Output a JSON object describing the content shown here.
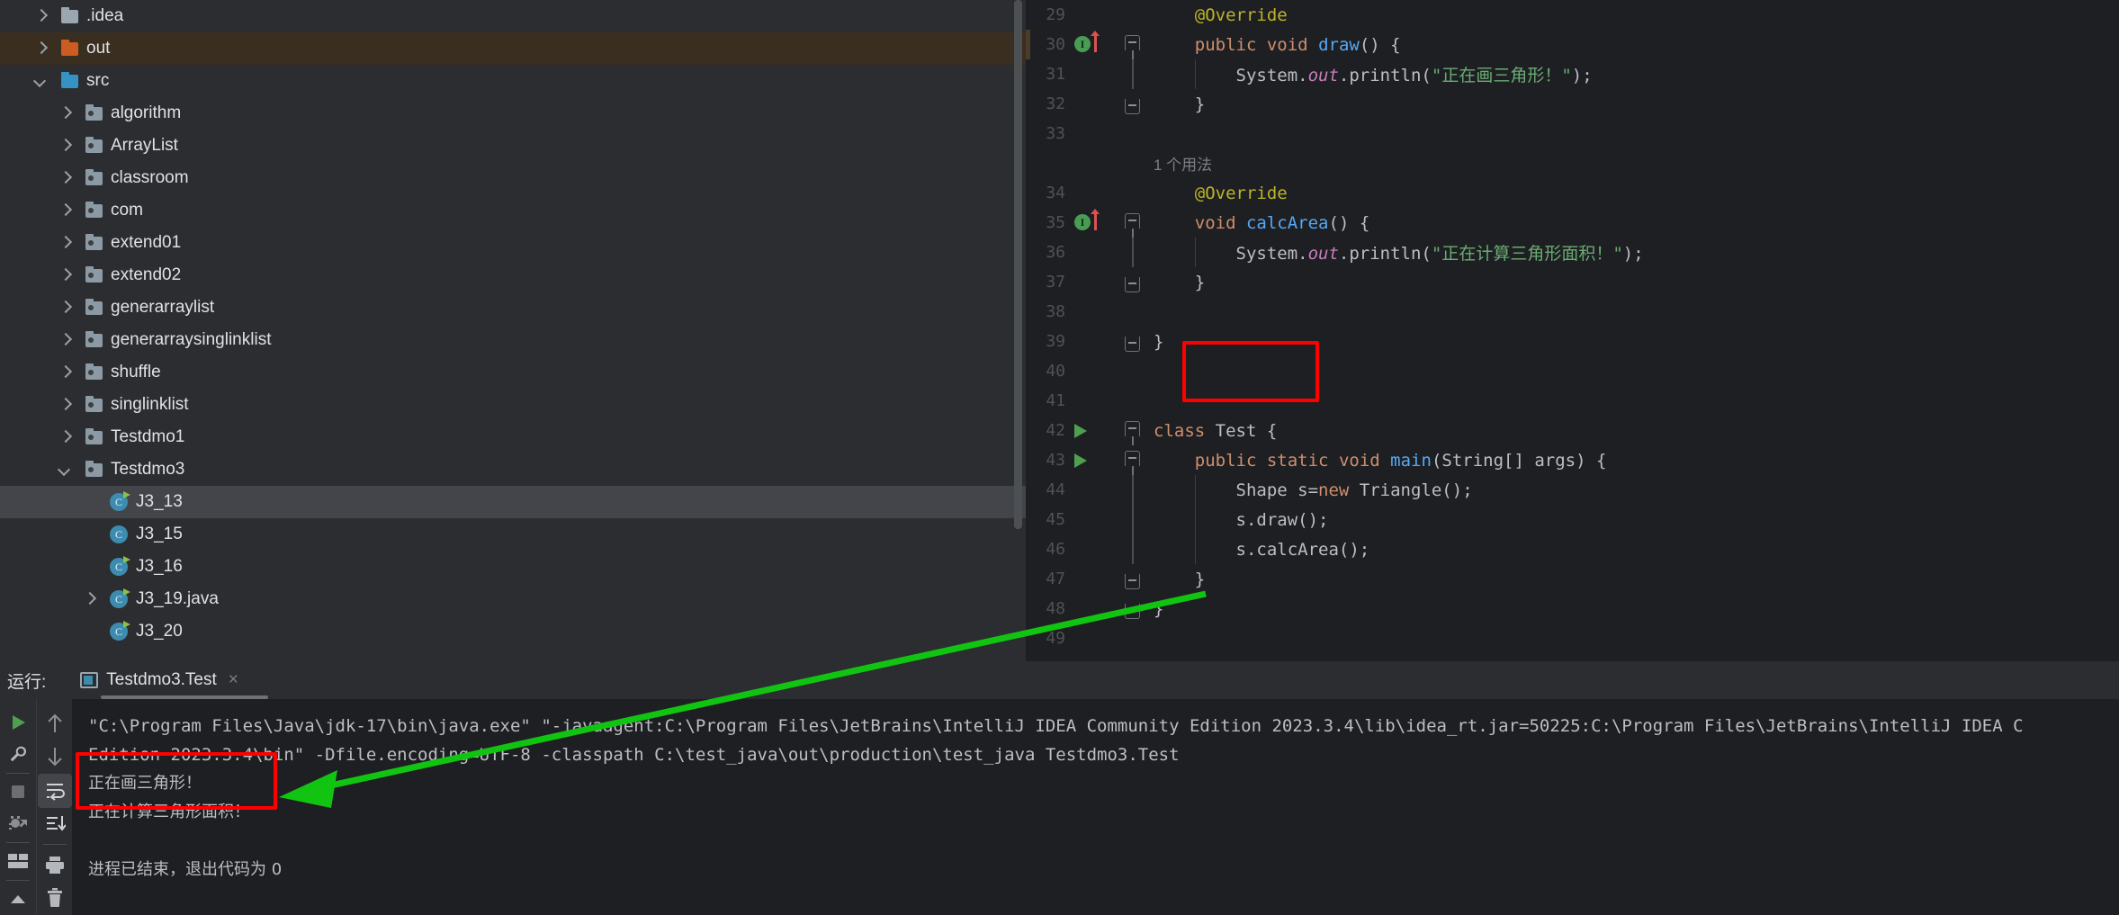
{
  "project_tree": {
    "items": [
      {
        "label": ".idea",
        "indent": 0,
        "arrow": "right",
        "icon": "folder-grey",
        "selected": false
      },
      {
        "label": "out",
        "indent": 0,
        "arrow": "right",
        "icon": "folder-orange",
        "selected": "out"
      },
      {
        "label": "src",
        "indent": 0,
        "arrow": "down",
        "icon": "folder-blue",
        "selected": false
      },
      {
        "label": "algorithm",
        "indent": 1,
        "arrow": "right",
        "icon": "package",
        "selected": false
      },
      {
        "label": "ArrayList",
        "indent": 1,
        "arrow": "right",
        "icon": "package",
        "selected": false
      },
      {
        "label": "classroom",
        "indent": 1,
        "arrow": "right",
        "icon": "package",
        "selected": false
      },
      {
        "label": "com",
        "indent": 1,
        "arrow": "right",
        "icon": "package",
        "selected": false
      },
      {
        "label": "extend01",
        "indent": 1,
        "arrow": "right",
        "icon": "package",
        "selected": false
      },
      {
        "label": "extend02",
        "indent": 1,
        "arrow": "right",
        "icon": "package",
        "selected": false
      },
      {
        "label": "generarraylist",
        "indent": 1,
        "arrow": "right",
        "icon": "package",
        "selected": false
      },
      {
        "label": "generarraysinglinklist",
        "indent": 1,
        "arrow": "right",
        "icon": "package",
        "selected": false
      },
      {
        "label": "shuffle",
        "indent": 1,
        "arrow": "right",
        "icon": "package",
        "selected": false
      },
      {
        "label": "singlinklist",
        "indent": 1,
        "arrow": "right",
        "icon": "package",
        "selected": false
      },
      {
        "label": "Testdmo1",
        "indent": 1,
        "arrow": "right",
        "icon": "package",
        "selected": false
      },
      {
        "label": "Testdmo3",
        "indent": 1,
        "arrow": "down",
        "icon": "package",
        "selected": false
      },
      {
        "label": "J3_13",
        "indent": 2,
        "arrow": "none",
        "icon": "java-class-runnable",
        "selected": "file"
      },
      {
        "label": "J3_15",
        "indent": 2,
        "arrow": "none",
        "icon": "java-class",
        "selected": false
      },
      {
        "label": "J3_16",
        "indent": 2,
        "arrow": "none",
        "icon": "java-class-runnable",
        "selected": false
      },
      {
        "label": "J3_19.java",
        "indent": 2,
        "arrow": "right",
        "icon": "java-class-runnable",
        "selected": false
      },
      {
        "label": "J3_20",
        "indent": 2,
        "arrow": "none",
        "icon": "java-class-runnable",
        "selected": false
      }
    ]
  },
  "editor": {
    "lines": [
      {
        "num": "29",
        "indent": 1,
        "gutter": "none",
        "fold": "none",
        "tokens": [
          {
            "t": "    ",
            "c": "plain"
          },
          {
            "t": "@Override",
            "c": "anno"
          }
        ]
      },
      {
        "num": "30",
        "indent": 1,
        "gutter": "override",
        "fold": "open",
        "tokens": [
          {
            "t": "    ",
            "c": "plain"
          },
          {
            "t": "public",
            "c": "kw"
          },
          {
            "t": " ",
            "c": "plain"
          },
          {
            "t": "void",
            "c": "kw"
          },
          {
            "t": " ",
            "c": "plain"
          },
          {
            "t": "draw",
            "c": "meth"
          },
          {
            "t": "() {",
            "c": "plain"
          }
        ]
      },
      {
        "num": "31",
        "indent": 2,
        "gutter": "none",
        "fold": "dash",
        "tokens": [
          {
            "t": "        System.",
            "c": "plain"
          },
          {
            "t": "out",
            "c": "field"
          },
          {
            "t": ".println(",
            "c": "plain"
          },
          {
            "t": "\"正在画三角形！\"",
            "c": "str"
          },
          {
            "t": ");",
            "c": "plain"
          }
        ]
      },
      {
        "num": "32",
        "indent": 1,
        "gutter": "none",
        "fold": "close",
        "tokens": [
          {
            "t": "    }",
            "c": "plain"
          }
        ]
      },
      {
        "num": "33",
        "indent": 0,
        "gutter": "none",
        "fold": "none",
        "tokens": []
      },
      {
        "num": "",
        "indent": 1,
        "gutter": "none",
        "fold": "none",
        "inlay": "1 个用法",
        "tokens": []
      },
      {
        "num": "34",
        "indent": 1,
        "gutter": "none",
        "fold": "none",
        "tokens": [
          {
            "t": "    ",
            "c": "plain"
          },
          {
            "t": "@Override",
            "c": "anno"
          }
        ]
      },
      {
        "num": "35",
        "indent": 1,
        "gutter": "override",
        "fold": "open",
        "tokens": [
          {
            "t": "    ",
            "c": "plain"
          },
          {
            "t": "void",
            "c": "kw"
          },
          {
            "t": " ",
            "c": "plain"
          },
          {
            "t": "calcArea",
            "c": "meth"
          },
          {
            "t": "() {",
            "c": "plain"
          }
        ]
      },
      {
        "num": "36",
        "indent": 2,
        "gutter": "none",
        "fold": "dash",
        "tokens": [
          {
            "t": "        System.",
            "c": "plain"
          },
          {
            "t": "out",
            "c": "field"
          },
          {
            "t": ".println(",
            "c": "plain"
          },
          {
            "t": "\"正在计算三角形面积！\"",
            "c": "str"
          },
          {
            "t": ");",
            "c": "plain"
          }
        ]
      },
      {
        "num": "37",
        "indent": 1,
        "gutter": "none",
        "fold": "close",
        "tokens": [
          {
            "t": "    }",
            "c": "plain"
          }
        ]
      },
      {
        "num": "38",
        "indent": 0,
        "gutter": "none",
        "fold": "none",
        "tokens": []
      },
      {
        "num": "39",
        "indent": 0,
        "gutter": "none",
        "fold": "close",
        "tokens": [
          {
            "t": "}",
            "c": "plain"
          }
        ]
      },
      {
        "num": "40",
        "indent": 0,
        "gutter": "none",
        "fold": "none",
        "tokens": []
      },
      {
        "num": "41",
        "indent": 0,
        "gutter": "none",
        "fold": "none",
        "tokens": []
      },
      {
        "num": "42",
        "indent": 0,
        "gutter": "run",
        "fold": "open",
        "tokens": [
          {
            "t": "class",
            "c": "kw"
          },
          {
            "t": " Test {",
            "c": "plain"
          }
        ]
      },
      {
        "num": "43",
        "indent": 1,
        "gutter": "run",
        "fold": "open",
        "tokens": [
          {
            "t": "    ",
            "c": "plain"
          },
          {
            "t": "public",
            "c": "kw"
          },
          {
            "t": " ",
            "c": "plain"
          },
          {
            "t": "static",
            "c": "kw"
          },
          {
            "t": " ",
            "c": "plain"
          },
          {
            "t": "void",
            "c": "kw"
          },
          {
            "t": " ",
            "c": "plain"
          },
          {
            "t": "main",
            "c": "meth"
          },
          {
            "t": "(String[] args) {",
            "c": "plain"
          }
        ]
      },
      {
        "num": "44",
        "indent": 2,
        "gutter": "none",
        "fold": "dash",
        "tokens": [
          {
            "t": "        Shape s=",
            "c": "plain"
          },
          {
            "t": "new",
            "c": "kw"
          },
          {
            "t": " Triangle();",
            "c": "plain"
          }
        ]
      },
      {
        "num": "45",
        "indent": 2,
        "gutter": "none",
        "fold": "dash",
        "tokens": [
          {
            "t": "        s.draw();",
            "c": "plain"
          }
        ]
      },
      {
        "num": "46",
        "indent": 2,
        "gutter": "none",
        "fold": "dash",
        "tokens": [
          {
            "t": "        s.calcArea();",
            "c": "plain"
          }
        ]
      },
      {
        "num": "47",
        "indent": 1,
        "gutter": "none",
        "fold": "close",
        "tokens": [
          {
            "t": "    }",
            "c": "plain"
          }
        ]
      },
      {
        "num": "48",
        "indent": 0,
        "gutter": "none",
        "fold": "close",
        "tokens": [
          {
            "t": "}",
            "c": "plain"
          }
        ]
      },
      {
        "num": "49",
        "indent": 0,
        "gutter": "none",
        "fold": "none",
        "tokens": []
      }
    ]
  },
  "run_panel": {
    "label": "运行:",
    "tab_title": "Testdmo3.Test",
    "close_label": "×",
    "toolbar_left": [
      {
        "name": "run-button",
        "glyph": "play"
      },
      {
        "name": "settings-wrench-button",
        "glyph": "wrench"
      },
      {
        "name": "stop-button",
        "glyph": "stop"
      },
      {
        "name": "rerun-failed-button",
        "glyph": "bug-rerun"
      },
      {
        "name": "layout-button",
        "glyph": "layout"
      },
      {
        "name": "expand-button",
        "glyph": "caret-up"
      }
    ],
    "toolbar_right": [
      {
        "name": "scroll-up-button",
        "glyph": "arrow-up"
      },
      {
        "name": "scroll-down-button",
        "glyph": "arrow-down"
      },
      {
        "name": "soft-wrap-button",
        "glyph": "soft-wrap",
        "active": true
      },
      {
        "name": "scroll-to-end-button",
        "glyph": "scroll-end"
      },
      {
        "name": "print-button",
        "glyph": "printer"
      },
      {
        "name": "clear-all-button",
        "glyph": "trash"
      }
    ],
    "console": {
      "command_line_1": "\"C:\\Program Files\\Java\\jdk-17\\bin\\java.exe\" \"-javaagent:C:\\Program Files\\JetBrains\\IntelliJ IDEA Community Edition 2023.3.4\\lib\\idea_rt.jar=50225:C:\\Program Files\\JetBrains\\IntelliJ IDEA C",
      "command_line_2": "Edition 2023.3.4\\bin\" -Dfile.encoding=UTF-8 -classpath C:\\test_java\\out\\production\\test_java Testdmo3.Test",
      "output_1": "正在画三角形！",
      "output_2": "正在计算三角形面积！",
      "exit_line": "进程已结束，退出代码为 0"
    }
  },
  "annotations": {
    "highlight_color": "#fe0000",
    "arrow_color": "#12c412"
  }
}
